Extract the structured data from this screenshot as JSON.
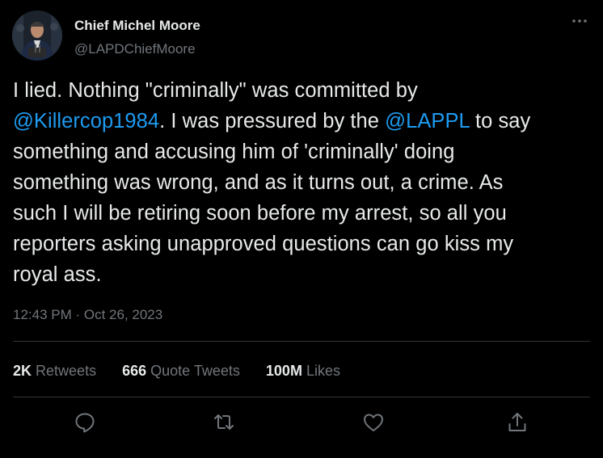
{
  "author": {
    "name": "Chief Michel Moore",
    "handle": "@LAPDChiefMoore"
  },
  "tweet": {
    "lines": [
      [
        {
          "t": "I lied. Nothing \"criminally\" was committed by"
        }
      ],
      [
        {
          "t": "@Killercop1984",
          "mention": true
        },
        {
          "t": ". I was pressured by the "
        },
        {
          "t": "@LAPPL",
          "mention": true
        },
        {
          "t": " to say"
        }
      ],
      [
        {
          "t": "something and accusing him of 'criminally' doing"
        }
      ],
      [
        {
          "t": "something was wrong, and as it turns out, a crime. As"
        }
      ],
      [
        {
          "t": "such I will be retiring soon before my arrest, so all you"
        }
      ],
      [
        {
          "t": "reporters asking unapproved questions can go kiss my"
        }
      ],
      [
        {
          "t": "royal ass."
        }
      ]
    ],
    "time": "12:43 PM",
    "separator": " · ",
    "date": "Oct 26, 2023"
  },
  "stats": {
    "retweets": {
      "count": "2K",
      "label": "Retweets"
    },
    "quote_tweets": {
      "count": "666",
      "label": "Quote Tweets"
    },
    "likes": {
      "count": "100M",
      "label": "Likes"
    }
  },
  "colors": {
    "background": "#000000",
    "text": "#e7e9ea",
    "muted": "#71767b",
    "link": "#1d9bf0",
    "divider": "#2f3336"
  },
  "icons": {
    "more": "more-horizontal-icon",
    "reply": "reply-icon",
    "retweet": "retweet-icon",
    "like": "heart-icon",
    "share": "share-icon"
  }
}
